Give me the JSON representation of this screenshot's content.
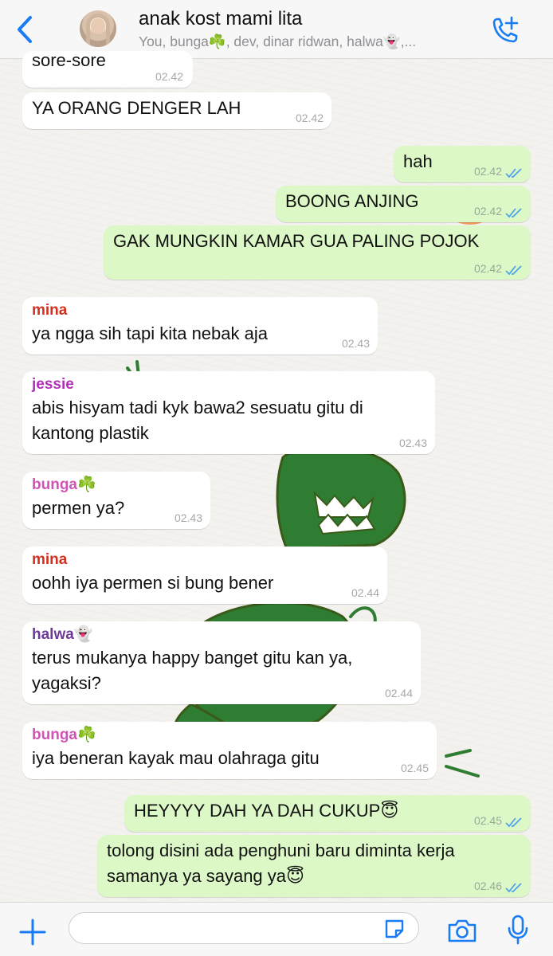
{
  "header": {
    "back_label": "<",
    "title": "anak kost mami lita",
    "subtitle": "You, bunga☘️, dev, dinar ridwan, halwa👻,..."
  },
  "messages": [
    {
      "dir": "in",
      "sender": "",
      "text": "sore-sore",
      "time": "02.42"
    },
    {
      "dir": "in",
      "sender": "",
      "text": "YA ORANG DENGER LAH",
      "time": "02.42"
    },
    {
      "dir": "out",
      "sender": "",
      "text": "hah",
      "time": "02.42"
    },
    {
      "dir": "out",
      "sender": "",
      "text": "BOONG ANJING",
      "time": "02.42"
    },
    {
      "dir": "out",
      "sender": "",
      "text": "GAK MUNGKIN KAMAR GUA PALING POJOK",
      "time": "02.42"
    },
    {
      "dir": "in",
      "sender": "mina",
      "text": "ya ngga sih tapi kita nebak aja",
      "time": "02.43"
    },
    {
      "dir": "in",
      "sender": "jessie",
      "text": "abis hisyam tadi kyk bawa2 sesuatu gitu di kantong plastik",
      "time": "02.43"
    },
    {
      "dir": "in",
      "sender": "bunga☘️",
      "text": "permen ya?",
      "time": "02.43"
    },
    {
      "dir": "in",
      "sender": "mina",
      "text": "oohh iya permen si bung bener",
      "time": "02.44"
    },
    {
      "dir": "in",
      "sender": "halwa👻",
      "text": "terus mukanya happy banget gitu kan ya, yagaksi?",
      "time": "02.44"
    },
    {
      "dir": "in",
      "sender": "bunga☘️",
      "text": "iya beneran kayak mau olahraga gitu",
      "time": "02.45"
    },
    {
      "dir": "out",
      "sender": "",
      "text": "HEYYYY DAH YA DAH CUKUP😇",
      "time": "02.45"
    },
    {
      "dir": "out",
      "sender": "",
      "text": "tolong disini ada penghuni baru diminta kerja samanya ya sayang ya😇",
      "time": "02.46"
    }
  ],
  "sender_colors": {
    "mina": "#d5301f",
    "jessie": "#b230b8",
    "bunga": "#d154b5",
    "halwa": "#6e3a9a"
  },
  "input": {
    "placeholder": ""
  },
  "colors": {
    "accent": "#1a7cf5",
    "outgoing_bubble": "#dcf8c6",
    "incoming_bubble": "#ffffff",
    "read_ticks": "#4fa3e8"
  },
  "icons": [
    "back-chevron-icon",
    "call-add-icon",
    "plus-icon",
    "sticker-icon",
    "camera-icon",
    "microphone-icon",
    "double-check-icon"
  ]
}
